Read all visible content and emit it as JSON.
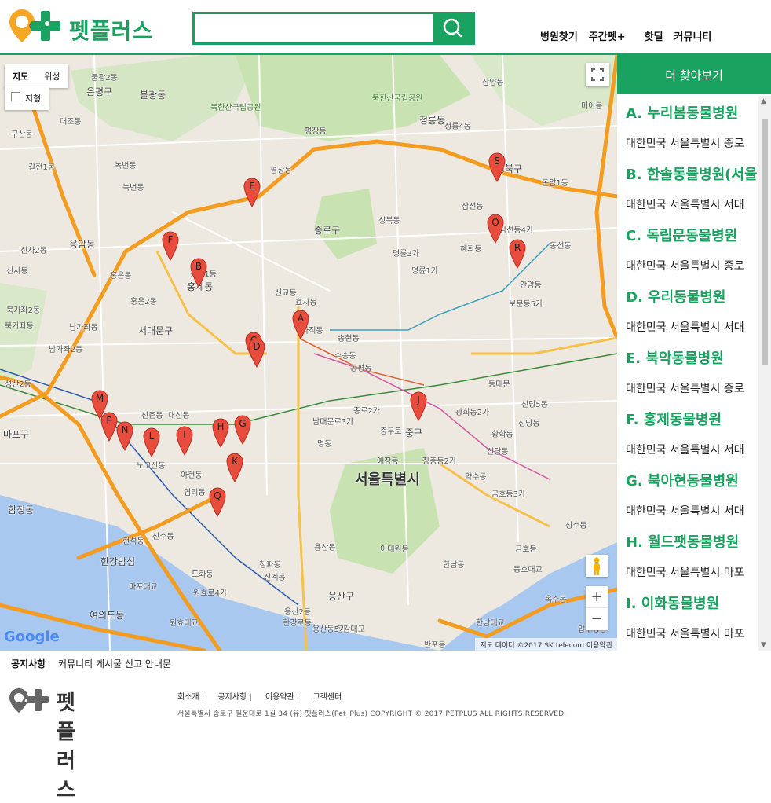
{
  "header": {
    "logo_text": "펫플러스",
    "search": {
      "value": "",
      "placeholder": ""
    },
    "nav": [
      "병원찾기",
      "주간펫+",
      "핫딜",
      "커뮤니티"
    ]
  },
  "map": {
    "type_tabs": {
      "map": "지도",
      "satellite": "위성"
    },
    "terrain_label": "지형",
    "google_logo": "Google",
    "attribution": "지도 데이터 ©2017 SK telecom   이용약관",
    "place_labels": [
      "불광2동",
      "은평구",
      "불광동",
      "대조동",
      "구산동",
      "녹번동",
      "녹번동",
      "응암동",
      "홍은동",
      "홍은2동",
      "홍제1동",
      "홍제동",
      "서대문구",
      "북가좌동",
      "남가좌동",
      "남가좌2동",
      "북가좌2동",
      "성산2동",
      "마포구",
      "신사2동",
      "신사동",
      "갈현1동",
      "북한산국립공원",
      "북한산국립공원",
      "정릉동",
      "정릉4동",
      "평창동",
      "평창동",
      "종로구",
      "성북동",
      "성북구",
      "돈암1동",
      "삼양동",
      "미아동",
      "삼선동",
      "삼선동4가",
      "명륜3가",
      "명륜1가",
      "안암동",
      "보문동5가",
      "동선동",
      "혜화동",
      "신교동",
      "효자동",
      "사직동",
      "송현동",
      "수송동",
      "공평동",
      "종로2가",
      "신당5동",
      "신당동",
      "동대문",
      "남대문로3가",
      "명동",
      "충무로",
      "중구",
      "황학동",
      "광희동2가",
      "신당동",
      "장충동2가",
      "약수동",
      "금호동3가",
      "서울특별시",
      "예장동",
      "용산구",
      "이태원동",
      "용산동",
      "한남동",
      "용산2동",
      "원효로4가",
      "원효대교",
      "한강대교",
      "마포대교",
      "한강밤섬",
      "여의도동",
      "합정동",
      "현석동",
      "도화동",
      "염리동",
      "아현동",
      "신촌동",
      "대신동",
      "노고산동",
      "신수동",
      "신계동",
      "청파동",
      "용산동5가",
      "한강로동",
      "동호대교",
      "금호동",
      "옥수동",
      "한남대교",
      "성수동",
      "압구정동",
      "반포동"
    ],
    "markers": [
      "A",
      "B",
      "C",
      "D",
      "E",
      "F",
      "G",
      "H",
      "I",
      "J",
      "K",
      "L",
      "M",
      "N",
      "O",
      "P",
      "Q",
      "R",
      "S"
    ],
    "colors": {
      "road_main": "#f39c1f",
      "water": "#a8c8f0",
      "park": "#c6e0b0",
      "land": "#ede9e0",
      "marker": "#e84c3d"
    }
  },
  "sidebar": {
    "title": "더 찾아보기",
    "items": [
      {
        "name": "A. 누리봄동물병원",
        "address": "대한민국 서울특별시 종로"
      },
      {
        "name": "B. 한솔동물병원(서울",
        "address": "대한민국 서울특별시 서대"
      },
      {
        "name": "C. 독립문동물병원",
        "address": "대한민국 서울특별시 종로"
      },
      {
        "name": "D. 우리동물병원",
        "address": "대한민국 서울특별시 서대"
      },
      {
        "name": "E. 북악동물병원",
        "address": "대한민국 서울특별시 종로"
      },
      {
        "name": "F. 홍제동물병원",
        "address": "대한민국 서울특별시 서대"
      },
      {
        "name": "G. 북아현동물병원",
        "address": "대한민국 서울특별시 서대"
      },
      {
        "name": "H. 월드팻동물병원",
        "address": "대한민국 서울특별시 마포"
      },
      {
        "name": "I. 이화동물병원",
        "address": "대한민국 서울특별시 마포"
      }
    ]
  },
  "notice": {
    "label": "공지사항",
    "text": "커뮤니티 게시물 신고 안내문"
  },
  "footer": {
    "logo_text": "펫플러스",
    "links": [
      "회소개 |",
      "공지사항 |",
      "이용약관 |",
      "고객센터"
    ],
    "copyright": "서울특별시 종로구 필운대로 1길 34 (유) 펫플러스(Pet_Plus) COPYRIGHT © 2017 PETPLUS ALL RIGHTS RESERVED."
  }
}
